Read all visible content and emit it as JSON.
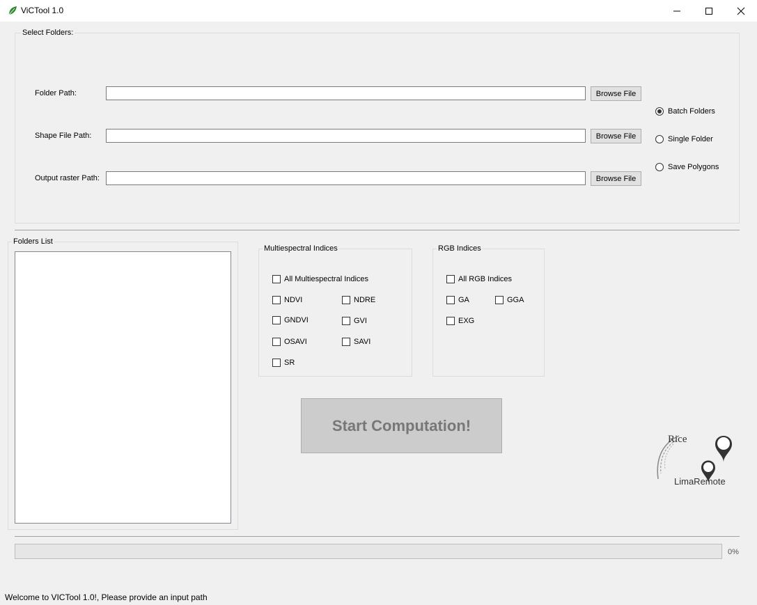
{
  "window": {
    "title": "ViCTool 1.0",
    "controls": [
      "minimize-icon",
      "maximize-icon",
      "close-icon"
    ]
  },
  "select_folders": {
    "group_title": "Select Folders:",
    "rows": [
      {
        "label": "Folder Path:",
        "value": "",
        "button": "Browse File"
      },
      {
        "label": "Shape File Path:",
        "value": "",
        "button": "Browse File"
      },
      {
        "label": "Output raster Path:",
        "value": "",
        "button": "Browse File"
      }
    ],
    "modes": [
      {
        "label": "Batch Folders",
        "selected": true
      },
      {
        "label": "Single Folder",
        "selected": false
      },
      {
        "label": "Save Polygons",
        "selected": false
      }
    ]
  },
  "folders_list": {
    "group_title": "Folders  List",
    "items": []
  },
  "multispectral": {
    "group_title": "Multiespectral Indices",
    "all_label": "All  Multiespectral Indices",
    "items": [
      {
        "label": "NDVI",
        "checked": false
      },
      {
        "label": "NDRE",
        "checked": false
      },
      {
        "label": "GNDVI",
        "checked": false
      },
      {
        "label": "GVI",
        "checked": false
      },
      {
        "label": "OSAVI",
        "checked": false
      },
      {
        "label": "SAVI",
        "checked": false
      },
      {
        "label": "SR",
        "checked": false
      }
    ]
  },
  "rgb": {
    "group_title": "RGB Indices",
    "all_label": "All  RGB Indices",
    "items": [
      {
        "label": "GA",
        "checked": false
      },
      {
        "label": "GGA",
        "checked": false
      },
      {
        "label": "EXG",
        "checked": false
      }
    ]
  },
  "start_button": "Start Computation!",
  "progress": {
    "value": 0,
    "text": "0%"
  },
  "status": "Welcome to VICTool 1.0!, Please provide an input path",
  "logo": {
    "text_top": "Rice",
    "text_bottom": "LimaRemote"
  },
  "colors": {
    "leaf": "#2e8b2e",
    "button_disabled_text": "#777777"
  }
}
